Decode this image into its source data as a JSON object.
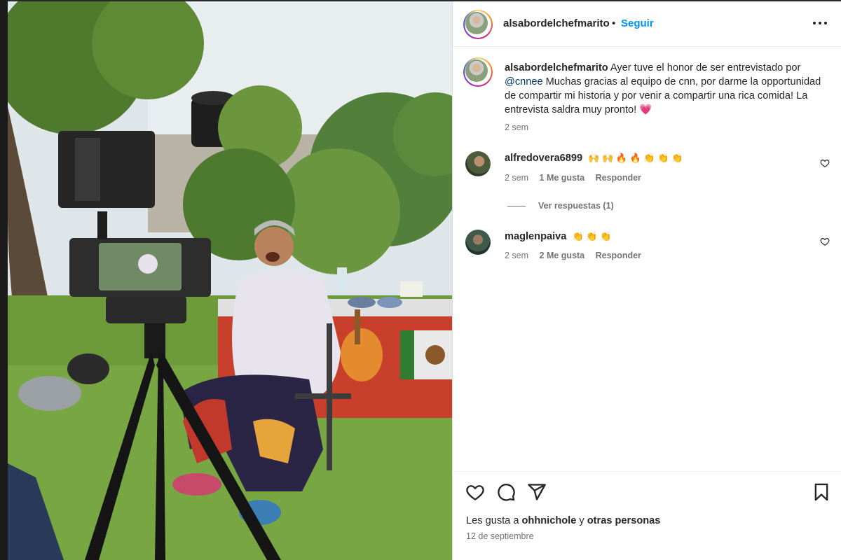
{
  "post": {
    "username": "alsabordelchefmarito",
    "dot": "•",
    "follow_label": "Seguir",
    "caption": {
      "username": "alsabordelchefmarito",
      "text_before_mention": " Ayer tuve el honor de ser entrevistado por ",
      "mention": "@cnnee",
      "text_after_mention": " Muchas gracias al equipo de cnn, por darme la opportunidad de compartir mi historia y por venir a compartir una rica comida! La entrevista saldra muy pronto! ",
      "emoji": "💗",
      "time": "2 sem"
    },
    "comments": [
      {
        "username": "alfredovera6899",
        "text": "🙌 🙌 🔥 🔥 👏 👏 👏",
        "time": "2 sem",
        "likes": "1 Me gusta",
        "reply": "Responder",
        "view_replies": "Ver respuestas (1)"
      },
      {
        "username": "maglenpaiva",
        "text": "👏 👏 👏",
        "time": "2 sem",
        "likes": "2 Me gusta",
        "reply": "Responder"
      }
    ],
    "likes": {
      "prefix": "Les gusta a ",
      "user": "ohhnichole",
      "middle": " y ",
      "others": "otras personas"
    },
    "date": "12 de septiembre"
  },
  "icons": {
    "more": "more-horizontal-icon",
    "like": "heart-icon",
    "comment": "comment-icon",
    "share": "share-icon",
    "save": "bookmark-icon"
  },
  "colors": {
    "link": "#0095f6",
    "mention": "#00376b",
    "muted": "#737373",
    "text": "#262626"
  }
}
